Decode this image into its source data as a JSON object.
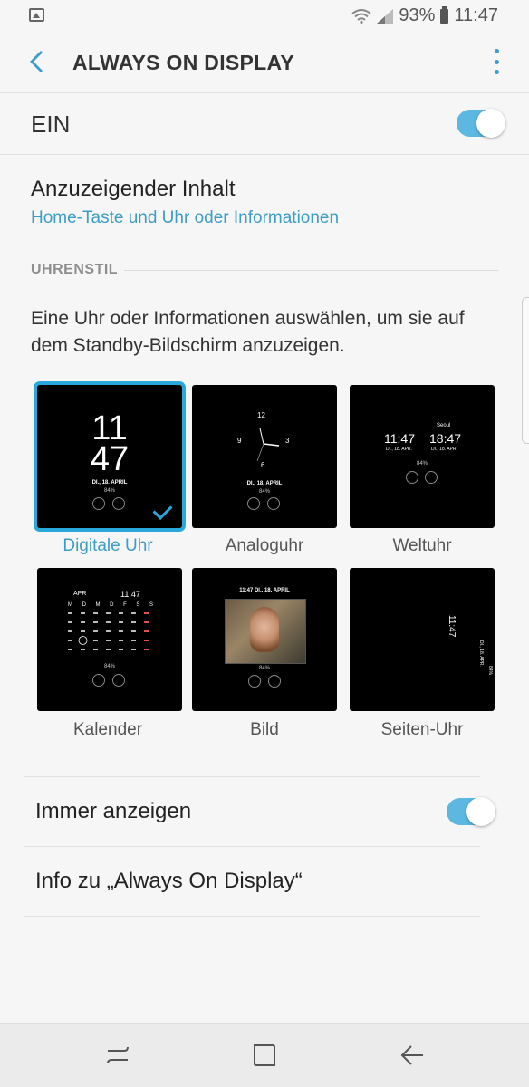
{
  "status_bar": {
    "battery": "93%",
    "time": "11:47"
  },
  "app_bar": {
    "title": "ALWAYS ON DISPLAY"
  },
  "master_switch": {
    "label": "EIN",
    "on": true
  },
  "content": {
    "title": "Anzuzeigender Inhalt",
    "value": "Home-Taste und Uhr oder Informationen"
  },
  "clock_style": {
    "header": "UHRENSTIL",
    "description": "Eine Uhr oder Informationen auswählen, um sie auf dem Standby-Bildschirm anzuzeigen.",
    "options": [
      {
        "label": "Digitale Uhr",
        "selected": true
      },
      {
        "label": "Analoguhr",
        "selected": false
      },
      {
        "label": "Weltuhr",
        "selected": false
      },
      {
        "label": "Kalender",
        "selected": false
      },
      {
        "label": "Bild",
        "selected": false
      },
      {
        "label": "Seiten-Uhr",
        "selected": false
      }
    ],
    "preview": {
      "digital_hour": "11",
      "digital_minute": "47",
      "date": "DI., 18. APRIL",
      "battery": "84%",
      "analog_numbers": [
        "12",
        "3",
        "6",
        "9"
      ],
      "world_city": "Seoul",
      "world_local_time": "11:47",
      "world_city_time": "18:47",
      "world_date": "DI., 18. APR.",
      "calendar_month": "APR",
      "calendar_time": "11:47",
      "calendar_days": [
        "M",
        "D",
        "M",
        "D",
        "F",
        "S",
        "S"
      ],
      "image_header": "11:47 DI., 18. APRIL",
      "edge_time": "11:47",
      "edge_date": "DI., 18. APR.",
      "edge_battery": "84%"
    }
  },
  "settings": [
    {
      "label": "Immer anzeigen",
      "toggle": true
    },
    {
      "label": "Info zu „Always On Display“"
    }
  ],
  "colors": {
    "accent": "#3c9dc7",
    "toggle_on": "#5cb8e0",
    "selection_border": "#29a8db"
  }
}
